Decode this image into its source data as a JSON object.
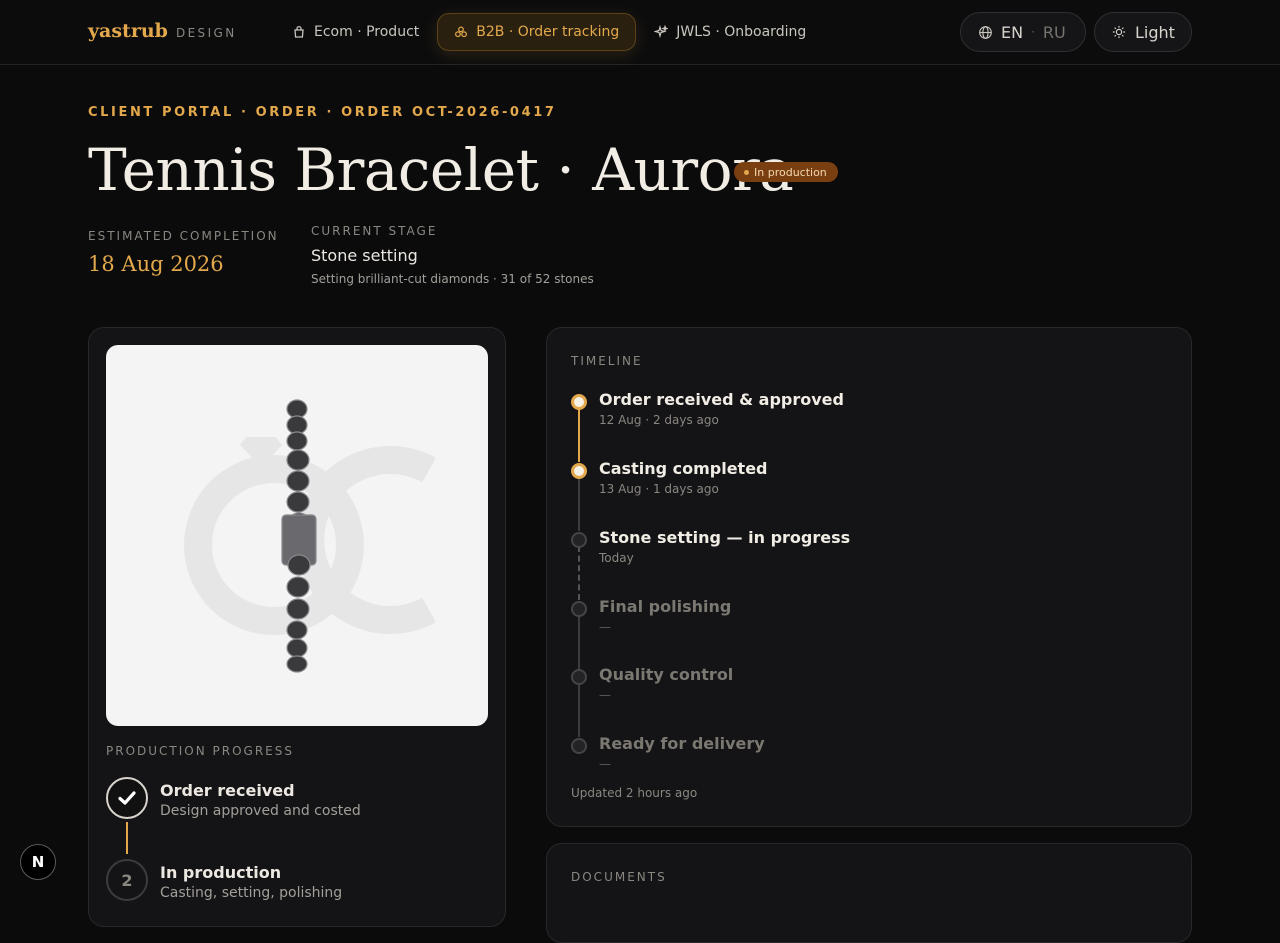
{
  "brand": {
    "name": "yastrub",
    "sub": "DESIGN"
  },
  "nav": [
    {
      "label": "Ecom · Product",
      "icon": "shopping-bag-icon"
    },
    {
      "label": "B2B · Order tracking",
      "icon": "gems-icon",
      "active": true
    },
    {
      "label": "JWLS · Onboarding",
      "icon": "sparkles-icon"
    }
  ],
  "lang": {
    "active": "EN",
    "separator": "·",
    "inactive": "RU"
  },
  "theme": {
    "label": "Light",
    "icon": "sun-icon"
  },
  "breadcrumb": "CLIENT PORTAL · ORDER · ORDER OCT-2026-0417",
  "title": "Tennis Bracelet · Aurora",
  "status_badge": "In production",
  "completion": {
    "label": "ESTIMATED COMPLETION",
    "value": "18 Aug 2026"
  },
  "stage": {
    "label": "CURRENT STAGE",
    "value": "Stone setting",
    "detail": "Setting brilliant-cut diamonds · 31 of 52 stones"
  },
  "progress": {
    "label": "PRODUCTION PROGRESS",
    "steps": [
      {
        "number": "",
        "title": "Order received",
        "desc": "Design approved and costed",
        "done": true
      },
      {
        "number": "2",
        "title": "In production",
        "desc": "Casting, setting, polishing",
        "done": false
      }
    ]
  },
  "timeline": {
    "label": "TIMELINE",
    "items": [
      {
        "title": "Order received & approved",
        "date": "12 Aug · 2 days ago",
        "state": "done"
      },
      {
        "title": "Casting completed",
        "date": "13 Aug · 1 days ago",
        "state": "done"
      },
      {
        "title": "Stone setting — in progress",
        "date": "Today",
        "state": "current"
      },
      {
        "title": "Final polishing",
        "date": "—",
        "state": "pending"
      },
      {
        "title": "Quality control",
        "date": "—",
        "state": "pending"
      },
      {
        "title": "Ready for delivery",
        "date": "—",
        "state": "pending"
      }
    ],
    "updated": "Updated 2 hours ago"
  },
  "documents": {
    "label": "DOCUMENTS"
  },
  "colors": {
    "accent": "#e3a84c",
    "background": "#0b0b0c",
    "card": "#141416",
    "badge": "#7a3f10"
  },
  "floating_badge": "N"
}
